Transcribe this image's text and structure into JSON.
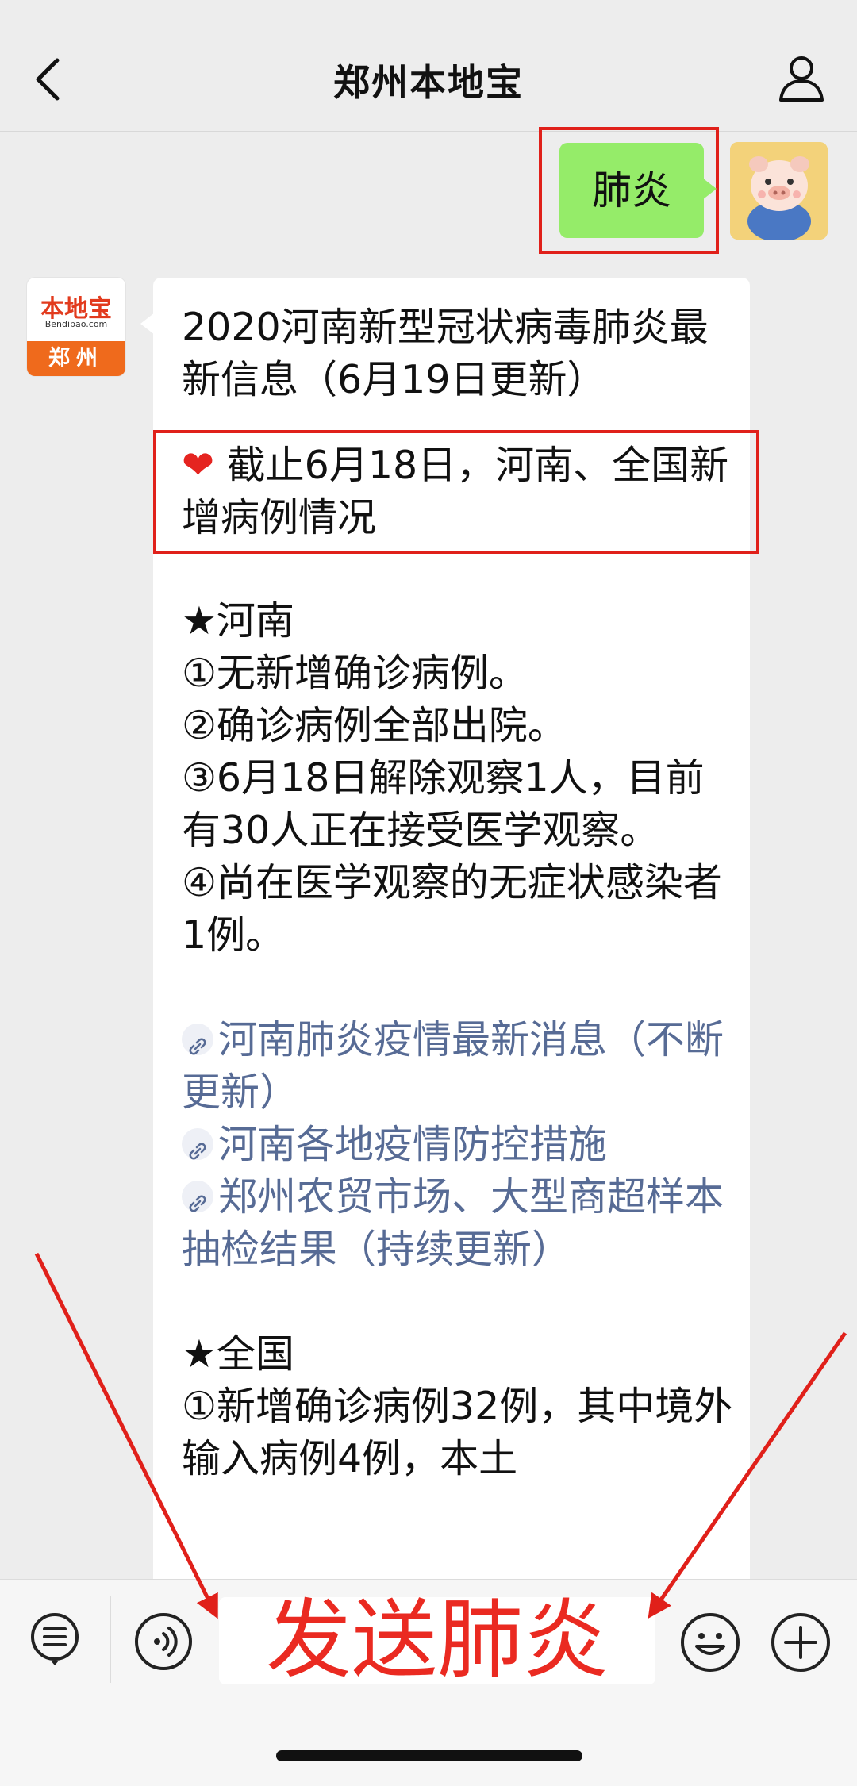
{
  "header": {
    "title": "郑州本地宝",
    "back_icon": "chevron-left-icon",
    "profile_icon": "person-icon"
  },
  "user_message": {
    "text": "肺炎",
    "avatar": "cartoon-pig-avatar"
  },
  "bot": {
    "brand": "本地宝",
    "domain": "Bendibao.com",
    "city": "郑州"
  },
  "bot_message": {
    "title": "2020河南新型冠状病毒肺炎最新信息（6月19日更新）",
    "highlight": "截止6月18日，河南、全国新增病例情况",
    "henan_header": "★河南",
    "henan_items": [
      "①无新增确诊病例。",
      "②确诊病例全部出院。",
      "③6月18日解除观察1人，目前有30人正在接受医学观察。",
      "④尚在医学观察的无症状感染者1例。"
    ],
    "links": [
      "河南肺炎疫情最新消息（不断更新）",
      "河南各地疫情防控措施",
      "郑州农贸市场、大型商超样本抽检结果（持续更新）"
    ],
    "nation_header": "★全国",
    "nation_items": [
      "①新增确诊病例32例，其中境外输入病例4例，本土"
    ]
  },
  "input_bar": {
    "text": "发送肺炎"
  },
  "colors": {
    "annotation_red": "#e0201a",
    "user_bubble": "#95ec69",
    "link": "#576b95"
  }
}
